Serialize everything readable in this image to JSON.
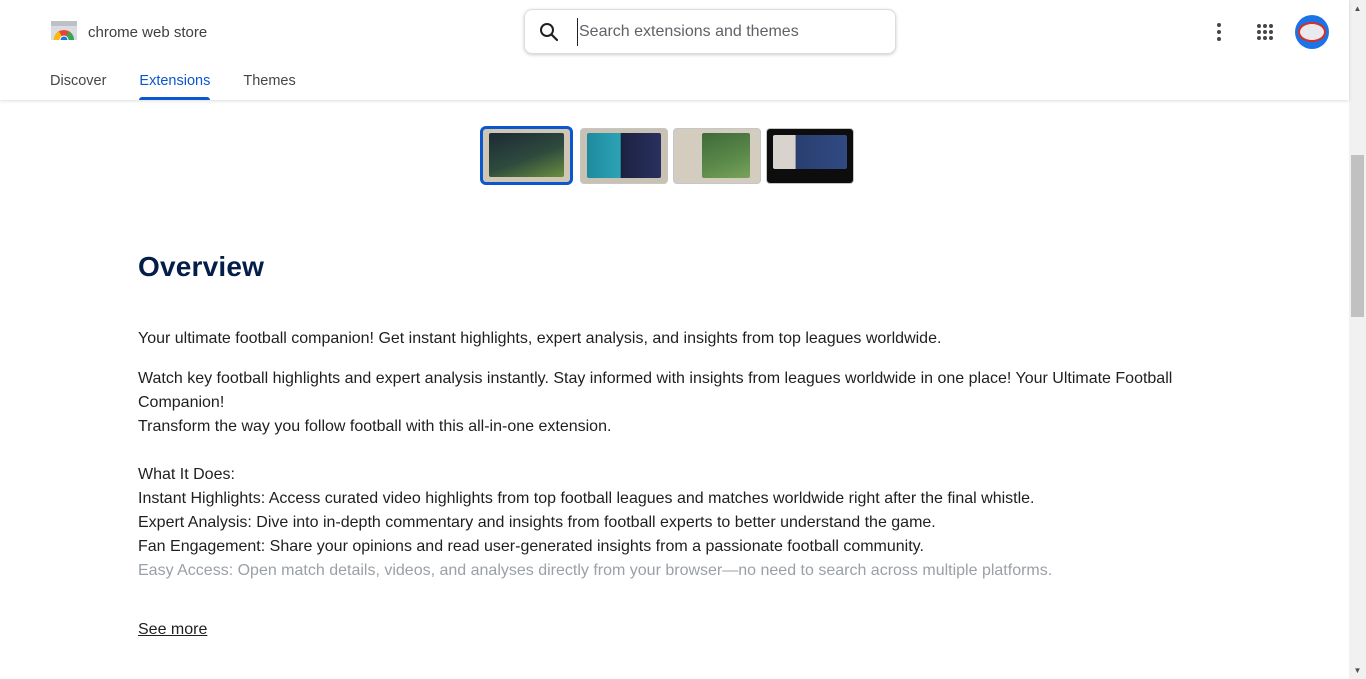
{
  "app": {
    "brand_name": "chrome web store"
  },
  "search": {
    "placeholder": "Search extensions and themes",
    "value": ""
  },
  "tabs": [
    {
      "label": "Discover",
      "active": false
    },
    {
      "label": "Extensions",
      "active": true
    },
    {
      "label": "Themes",
      "active": false
    }
  ],
  "icons": {
    "more": "more-vert-icon",
    "apps": "apps-grid-icon",
    "search": "search-icon"
  },
  "colors": {
    "accent": "#0b57d0",
    "heading": "#041e49",
    "avatar_bg": "#1a73e8"
  },
  "screenshots": {
    "count": 4,
    "selected_index": 0
  },
  "overview": {
    "title": "Overview",
    "summary": "Your ultimate football companion! Get instant highlights, expert analysis, and insights from top leagues worldwide.",
    "paragraph1_line1": "Watch key football highlights and expert analysis instantly. Stay informed with insights from leagues worldwide in one place! Your Ultimate Football Companion!",
    "paragraph1_line2": "Transform the way you follow football with this all-in-one extension.",
    "what_it_does": "What It Does:",
    "features": [
      "Instant Highlights: Access curated video highlights from top football leagues and matches worldwide right after the final whistle.",
      "Expert Analysis: Dive into in-depth commentary and insights from football experts to better understand the game.",
      "Fan Engagement: Share your opinions and read user-generated insights from a passionate football community.",
      "Easy Access: Open match details, videos, and analyses directly from your browser—no need to search across multiple platforms."
    ],
    "see_more": "See more"
  }
}
